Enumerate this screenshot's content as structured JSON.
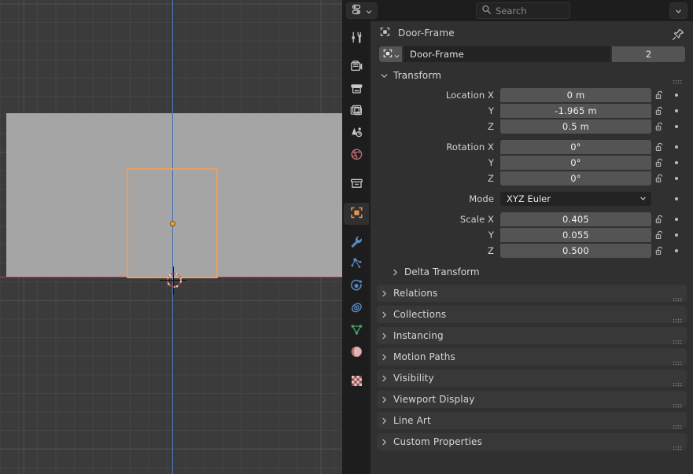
{
  "header": {
    "editor_type_icon": "properties-editor-icon",
    "search": {
      "placeholder": "Search",
      "value": ""
    },
    "options_dropdown_icon": "chevron-down-icon"
  },
  "tabs": [
    {
      "name": "tool",
      "icon": "tool-icon",
      "active": false
    },
    {
      "name": "render",
      "icon": "camera-back-icon",
      "active": false
    },
    {
      "name": "output",
      "icon": "printer-icon",
      "active": false
    },
    {
      "name": "view-layer",
      "icon": "images-icon",
      "active": false
    },
    {
      "name": "scene",
      "icon": "scene-cone-icon",
      "active": false
    },
    {
      "name": "world",
      "icon": "world-globe-icon",
      "active": false
    },
    {
      "name": "collection",
      "icon": "collection-box-icon",
      "active": false
    },
    {
      "name": "object",
      "icon": "object-square-icon",
      "active": true
    },
    {
      "name": "modifiers",
      "icon": "wrench-icon",
      "active": false
    },
    {
      "name": "particles",
      "icon": "particles-icon",
      "active": false
    },
    {
      "name": "physics",
      "icon": "physics-orbit-icon",
      "active": false
    },
    {
      "name": "constraints",
      "icon": "constraint-icon",
      "active": false
    },
    {
      "name": "object-data",
      "icon": "mesh-data-triangle-icon",
      "active": false
    },
    {
      "name": "material",
      "icon": "material-sphere-icon",
      "active": false
    },
    {
      "name": "texture",
      "icon": "texture-checker-icon",
      "active": false
    }
  ],
  "breadcrumb": {
    "icon": "object-square-icon",
    "label": "Door-Frame",
    "pin_icon": "pin-icon"
  },
  "id_block": {
    "type_icon": "object-square-icon",
    "type_chevron_icon": "chevron-down-icon",
    "name": "Door-Frame",
    "users": "2"
  },
  "transform": {
    "title": "Transform",
    "expanded": true,
    "chevron_icon": "chevron-down-icon",
    "grip_icon": "drag-grip-icon",
    "rows": [
      {
        "label": "Location X",
        "value": "0 m",
        "field": "number",
        "lock": "unlocked-padlock-icon",
        "deco": "animate-dot-icon",
        "stack": "top",
        "group_start": false
      },
      {
        "label": "Y",
        "value": "-1.965 m",
        "field": "number",
        "lock": "unlocked-padlock-icon",
        "deco": "animate-dot-icon",
        "stack": "mid",
        "group_start": false
      },
      {
        "label": "Z",
        "value": "0.5 m",
        "field": "number",
        "lock": "unlocked-padlock-icon",
        "deco": "animate-dot-icon",
        "stack": "bot",
        "group_start": false
      },
      {
        "label": "Rotation X",
        "value": "0°",
        "field": "number",
        "lock": "unlocked-padlock-icon",
        "deco": "animate-dot-icon",
        "stack": "top",
        "group_start": true
      },
      {
        "label": "Y",
        "value": "0°",
        "field": "number",
        "lock": "unlocked-padlock-icon",
        "deco": "animate-dot-icon",
        "stack": "mid",
        "group_start": false
      },
      {
        "label": "Z",
        "value": "0°",
        "field": "number",
        "lock": "unlocked-padlock-icon",
        "deco": "animate-dot-icon",
        "stack": "bot",
        "group_start": false
      },
      {
        "label": "Mode",
        "value": "XYZ Euler",
        "field": "enum",
        "lock": "",
        "deco": "animate-dot-icon",
        "stack": "one",
        "group_start": true
      },
      {
        "label": "Scale X",
        "value": "0.405",
        "field": "number",
        "lock": "unlocked-padlock-icon",
        "deco": "animate-dot-icon",
        "stack": "top",
        "group_start": true
      },
      {
        "label": "Y",
        "value": "0.055",
        "field": "number",
        "lock": "unlocked-padlock-icon",
        "deco": "animate-dot-icon",
        "stack": "mid",
        "group_start": false
      },
      {
        "label": "Z",
        "value": "0.500",
        "field": "number",
        "lock": "unlocked-padlock-icon",
        "deco": "animate-dot-icon",
        "stack": "bot",
        "group_start": false
      }
    ],
    "subpanel": {
      "label": "Delta Transform",
      "chevron_icon": "chevron-right-icon"
    }
  },
  "panels": [
    {
      "label": "Relations",
      "chevron_icon": "chevron-right-icon",
      "grip_icon": "drag-grip-icon"
    },
    {
      "label": "Collections",
      "chevron_icon": "chevron-right-icon",
      "grip_icon": "drag-grip-icon"
    },
    {
      "label": "Instancing",
      "chevron_icon": "chevron-right-icon",
      "grip_icon": "drag-grip-icon"
    },
    {
      "label": "Motion Paths",
      "chevron_icon": "chevron-right-icon",
      "grip_icon": "drag-grip-icon"
    },
    {
      "label": "Visibility",
      "chevron_icon": "chevron-right-icon",
      "grip_icon": "drag-grip-icon"
    },
    {
      "label": "Viewport Display",
      "chevron_icon": "chevron-right-icon",
      "grip_icon": "drag-grip-icon"
    },
    {
      "label": "Line Art",
      "chevron_icon": "chevron-right-icon",
      "grip_icon": "drag-grip-icon"
    },
    {
      "label": "Custom Properties",
      "chevron_icon": "chevron-right-icon",
      "grip_icon": "drag-grip-icon"
    }
  ],
  "viewport": {
    "selected_object_outline_color": "#ed9e5c",
    "plane_color": "#a5a5a5",
    "axis_x_color": "#cc3747",
    "axis_z_color": "#4772b3",
    "grid_color": "#454545",
    "background_color": "#3b3b3b"
  }
}
